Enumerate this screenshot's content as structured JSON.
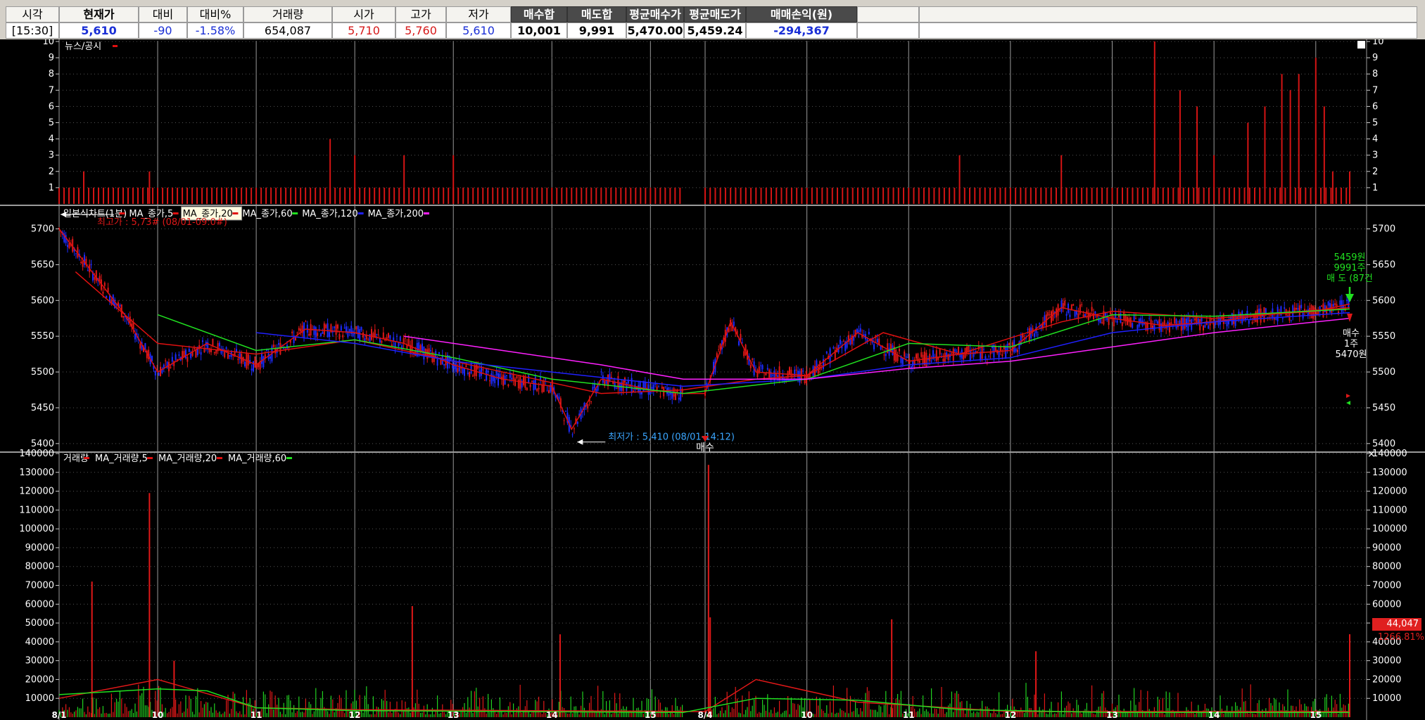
{
  "header": {
    "labels": [
      "시각",
      "현재가",
      "대비",
      "대비%",
      "거래량",
      "시가",
      "고가",
      "저가",
      "매수합",
      "매도합",
      "평균매수가",
      "평균매도가",
      "매매손익(원)"
    ],
    "values": [
      "[15:30]",
      "5,610",
      "-90",
      "-1.58%",
      "654,087",
      "5,710",
      "5,760",
      "5,610",
      "10,001",
      "9,991",
      "5,470.00",
      "5,459.24",
      "-294,367"
    ],
    "colors": {
      "blue": "#1a2fd6",
      "red": "#d61a1a",
      "black": "#000000",
      "dark_header": "#4a4a4a"
    }
  },
  "panels": {
    "news": {
      "title": "뉴스/공시",
      "close_icon": "close-icon"
    },
    "price": {
      "legend": [
        "일본식차트(1분)",
        "MA_종가,5",
        "MA_종가,20",
        "MA_종가,60",
        "MA_종가,120",
        "MA_종가,200"
      ],
      "legend_colors": [
        "#e01010",
        "#e01010",
        "#e01010",
        "#20e020",
        "#2020ff",
        "#ff20ff"
      ],
      "high_annotation": "최고가 : 5,73# (08/01-09:0#)",
      "low_annotation": "최저가 : 5,410 (08/01-14:12)",
      "buy_marker_label": "매수",
      "sell_annotation": [
        "5459원",
        "9991주",
        "매 도 (87건"
      ],
      "buy_annotation": [
        "매수",
        "1주",
        "5470원"
      ]
    },
    "volume": {
      "legend": [
        "거래량",
        "MA_거래량,5",
        "MA_거래량,20",
        "MA_거래량,60"
      ],
      "legend_colors": [
        "#e01010",
        "#e01010",
        "#e01010",
        "#20e020"
      ],
      "last_value_badge": "44,047",
      "last_pct_badge": "1266.81%"
    }
  },
  "chart_data": [
    {
      "type": "bar",
      "name": "뉴스/공시",
      "ylim": [
        0,
        10
      ],
      "yticks": [
        1,
        2,
        3,
        4,
        5,
        6,
        7,
        8,
        9,
        10
      ],
      "notable_values": [
        {
          "x": "8/1 09:15",
          "y": 2
        },
        {
          "x": "8/1 09:55",
          "y": 2
        },
        {
          "x": "8/1 11:45",
          "y": 4
        },
        {
          "x": "8/1 12:00",
          "y": 3
        },
        {
          "x": "8/1 12:30",
          "y": 3
        },
        {
          "x": "8/1 13:00",
          "y": 3
        },
        {
          "x": "8/4 11:30",
          "y": 3
        },
        {
          "x": "8/4 12:30",
          "y": 3
        },
        {
          "x": "8/4 13:25",
          "y": 10
        },
        {
          "x": "8/4 13:40",
          "y": 7
        },
        {
          "x": "8/4 13:50",
          "y": 6
        },
        {
          "x": "8/4 14:00",
          "y": 3
        },
        {
          "x": "8/4 14:20",
          "y": 5
        },
        {
          "x": "8/4 14:30",
          "y": 6
        },
        {
          "x": "8/4 14:40",
          "y": 8
        },
        {
          "x": "8/4 14:45",
          "y": 7
        },
        {
          "x": "8/4 14:50",
          "y": 8
        },
        {
          "x": "8/4 15:00",
          "y": 9
        },
        {
          "x": "8/4 15:05",
          "y": 6
        },
        {
          "x": "8/4 15:10",
          "y": 2
        },
        {
          "x": "8/4 15:20",
          "y": 2
        }
      ]
    },
    {
      "type": "line",
      "name": "일본식차트(1분)",
      "ylim": [
        5390,
        5730
      ],
      "yticks": [
        5400,
        5450,
        5500,
        5550,
        5600,
        5650,
        5700
      ],
      "x_session_labels": [
        "8/1",
        "10",
        "11",
        "12",
        "13",
        "14",
        "15",
        "8/4",
        "10",
        "11",
        "12",
        "13",
        "14",
        "15"
      ],
      "series": [
        {
          "name": "MA_종가,5",
          "x": [
            "8/1 09:00",
            "8/1 09:20",
            "8/1 09:40",
            "8/1 10:00",
            "8/1 10:30",
            "8/1 11:00",
            "8/1 11:30",
            "8/1 12:00",
            "8/1 12:30",
            "8/1 13:00",
            "8/1 13:30",
            "8/1 14:00",
            "8/1 14:12",
            "8/1 14:30",
            "8/1 15:00",
            "8/1 15:20",
            "8/4 09:00",
            "8/4 09:15",
            "8/4 09:30",
            "8/4 10:00",
            "8/4 10:30",
            "8/4 11:00",
            "8/4 11:30",
            "8/4 12:00",
            "8/4 12:30",
            "8/4 13:00",
            "8/4 13:30",
            "8/4 14:00",
            "8/4 14:30",
            "8/4 15:00",
            "8/4 15:20"
          ],
          "y": [
            5700,
            5640,
            5580,
            5500,
            5540,
            5510,
            5560,
            5555,
            5540,
            5510,
            5490,
            5480,
            5420,
            5490,
            5475,
            5470,
            5470,
            5570,
            5500,
            5495,
            5555,
            5515,
            5525,
            5530,
            5590,
            5575,
            5565,
            5570,
            5580,
            5585,
            5595
          ]
        },
        {
          "name": "MA_종가,20",
          "x": [
            "8/1 09:10",
            "8/1 10:00",
            "8/1 11:00",
            "8/1 12:00",
            "8/1 13:00",
            "8/1 14:00",
            "8/1 14:30",
            "8/1 15:20",
            "8/4 09:30",
            "8/4 10:00",
            "8/4 10:45",
            "8/4 11:30",
            "8/4 12:30",
            "8/4 13:00",
            "8/4 14:00",
            "8/4 15:20"
          ],
          "y": [
            5640,
            5540,
            5525,
            5545,
            5515,
            5485,
            5470,
            5475,
            5490,
            5495,
            5555,
            5525,
            5570,
            5585,
            5575,
            5590
          ]
        },
        {
          "name": "MA_종가,60",
          "x": [
            "8/1 10:00",
            "8/1 11:00",
            "8/1 12:00",
            "8/1 13:00",
            "8/1 14:00",
            "8/1 15:20",
            "8/4 10:00",
            "8/4 11:00",
            "8/4 12:00",
            "8/4 13:00",
            "8/4 14:00",
            "8/4 15:20"
          ],
          "y": [
            5580,
            5530,
            5545,
            5520,
            5490,
            5470,
            5490,
            5540,
            5535,
            5580,
            5578,
            5588
          ]
        },
        {
          "name": "MA_종가,120",
          "x": [
            "8/1 11:00",
            "8/1 12:00",
            "8/1 13:00",
            "8/1 14:00",
            "8/1 15:20",
            "8/4 10:00",
            "8/4 11:00",
            "8/4 12:00",
            "8/4 13:00",
            "8/4 14:00",
            "8/4 15:20"
          ],
          "y": [
            5555,
            5540,
            5515,
            5500,
            5480,
            5490,
            5510,
            5520,
            5555,
            5570,
            5583
          ]
        },
        {
          "name": "MA_종가,200",
          "x": [
            "8/1 12:30",
            "8/1 13:30",
            "8/1 14:30",
            "8/1 15:20",
            "8/4 10:00",
            "8/4 11:00",
            "8/4 12:00",
            "8/4 13:00",
            "8/4 14:00",
            "8/4 15:20"
          ],
          "y": [
            5550,
            5530,
            5510,
            5490,
            5490,
            5505,
            5515,
            5535,
            5555,
            5575
          ]
        }
      ]
    },
    {
      "type": "bar",
      "name": "거래량",
      "ylim": [
        0,
        140000
      ],
      "yticks": [
        10000,
        20000,
        30000,
        40000,
        50000,
        60000,
        70000,
        80000,
        90000,
        100000,
        110000,
        120000,
        130000,
        140000
      ],
      "notable_values": [
        {
          "x": "8/1 09:20",
          "y": 72000
        },
        {
          "x": "8/1 09:55",
          "y": 119000
        },
        {
          "x": "8/1 10:10",
          "y": 30000
        },
        {
          "x": "8/1 12:35",
          "y": 59000
        },
        {
          "x": "8/1 14:05",
          "y": 44000
        },
        {
          "x": "8/4 09:02",
          "y": 134000
        },
        {
          "x": "8/4 09:03",
          "y": 53000
        },
        {
          "x": "8/4 10:50",
          "y": 52000
        },
        {
          "x": "8/4 12:15",
          "y": 35000
        },
        {
          "x": "8/4 15:20",
          "y": 44047
        }
      ],
      "ma_series": [
        {
          "name": "MA_거래량,20",
          "x": [
            "8/1 09:00",
            "8/1 10:00",
            "8/1 11:00",
            "8/1 12:00",
            "8/4 09:00",
            "8/4 09:30",
            "8/4 10:30",
            "8/4 12:00",
            "8/4 15:20"
          ],
          "y": [
            10000,
            20000,
            5000,
            4000,
            3000,
            20000,
            8000,
            3000,
            3000
          ]
        },
        {
          "name": "MA_거래량,60",
          "x": [
            "8/1 09:00",
            "8/1 10:00",
            "8/1 10:30",
            "8/1 11:00",
            "8/1 12:00",
            "8/1 15:20",
            "8/4 09:30",
            "8/4 10:30",
            "8/4 11:30",
            "8/4 13:00",
            "8/4 15:20"
          ],
          "y": [
            12000,
            15000,
            14000,
            5000,
            3500,
            2500,
            10000,
            9000,
            4000,
            2500,
            2500
          ]
        }
      ]
    }
  ]
}
